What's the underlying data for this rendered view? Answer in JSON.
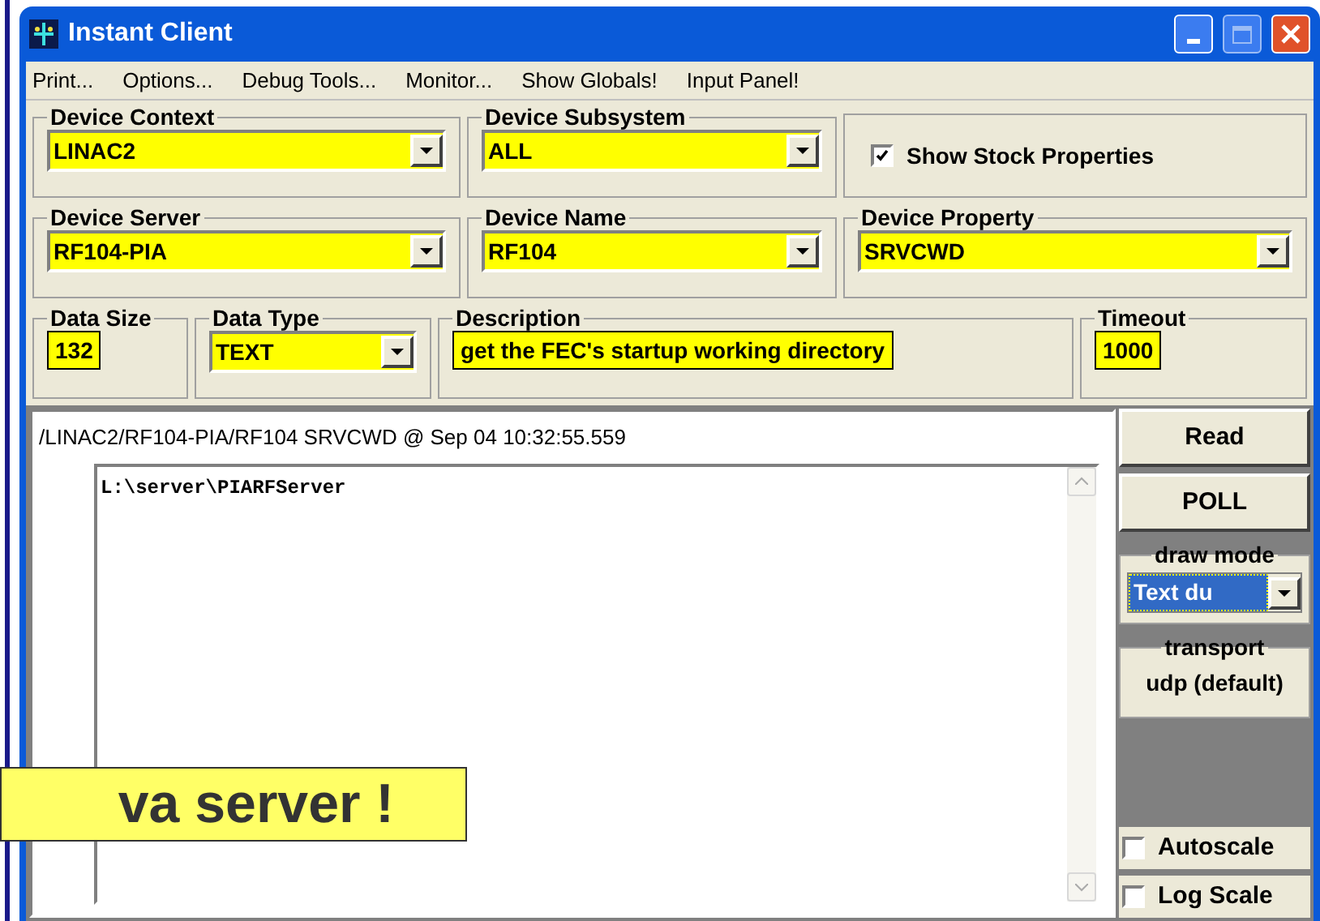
{
  "window": {
    "title": "Instant Client"
  },
  "menu": [
    {
      "label": "Print..."
    },
    {
      "label": "Options..."
    },
    {
      "label": "Debug Tools..."
    },
    {
      "label": "Monitor..."
    },
    {
      "label": "Show Globals!"
    },
    {
      "label": "Input Panel!"
    }
  ],
  "rows": [
    [
      {
        "kind": "combo",
        "label": "Device Context",
        "value": "LINAC2"
      },
      {
        "kind": "combo",
        "label": "Device Subsystem",
        "value": "ALL"
      },
      {
        "kind": "checkbox",
        "label": "Show Stock Properties",
        "checked": true
      }
    ],
    [
      {
        "kind": "combo",
        "label": "Device Server",
        "value": "RF104-PIA"
      },
      {
        "kind": "combo",
        "label": "Device Name",
        "value": "RF104"
      },
      {
        "kind": "combo",
        "label": "Device Property",
        "value": "SRVCWD"
      }
    ],
    [
      {
        "kind": "text",
        "label": "Data Size",
        "value": "132"
      },
      {
        "kind": "combo",
        "label": "Data Type",
        "value": "TEXT"
      },
      {
        "kind": "text",
        "label": "Description",
        "value": "get the FEC's startup working directory"
      },
      {
        "kind": "text",
        "label": "Timeout",
        "value": "1000"
      }
    ]
  ],
  "output": {
    "header": "/LINAC2/RF104-PIA/RF104 SRVCWD @ Sep 04 10:32:55.559",
    "text": "L:\\server\\PIARFServer"
  },
  "side": {
    "buttons": [
      "Read",
      "POLL"
    ],
    "draw_mode": {
      "label": "draw mode",
      "value": "Text du"
    },
    "transport": {
      "label": "transport",
      "value": "udp (default)"
    },
    "options": [
      {
        "label": "Autoscale",
        "checked": false
      },
      {
        "label": "Log Scale",
        "checked": false
      }
    ]
  },
  "callout": {
    "text": "va server !"
  }
}
